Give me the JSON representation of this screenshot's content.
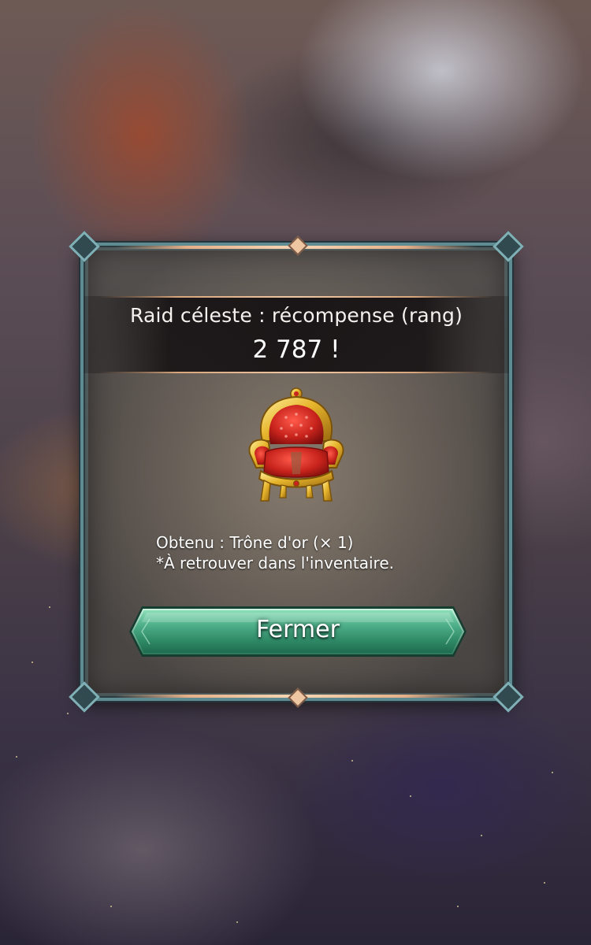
{
  "dialog": {
    "title": "Raid céleste : récompense (rang)",
    "rank": "2 787 !"
  },
  "reward": {
    "icon": "golden-throne-icon",
    "obtained": "Obtenu : Trône d'or (× 1)",
    "note": "*À retrouver dans l'inventaire."
  },
  "buttons": {
    "close_label": "Fermer"
  },
  "colors": {
    "frame": "#5f8b92",
    "accent_rule": "#e5b089",
    "button_green": "#3f9a76",
    "throne_red": "#c8231c",
    "throne_gold": "#e7b52c"
  }
}
